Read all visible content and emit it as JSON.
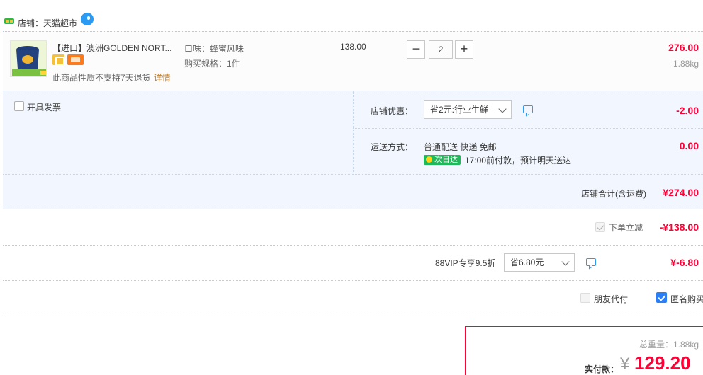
{
  "shop": {
    "label": "店铺：天猫超市"
  },
  "item": {
    "title": "【进口】澳洲GOLDEN NORT...",
    "no_return": "此商品性质不支持7天退货",
    "detail_link": "详情",
    "flavor": "口味：蜂蜜风味",
    "spec": "购买规格：1件",
    "unit_price": "138.00",
    "quantity": "2",
    "minus": "−",
    "plus": "+",
    "subtotal": "276.00",
    "weight": "1.88kg"
  },
  "invoice": {
    "label": "开具发票"
  },
  "promo": {
    "label": "店铺优惠：",
    "selected": "省2元:行业生鲜",
    "amount": "-2.00"
  },
  "shipping": {
    "label": "运送方式：",
    "method": "普通配送 快递 免邮",
    "badge": "次日达",
    "note": "17:00前付款，预计明天送达",
    "amount": "0.00"
  },
  "shop_total": {
    "label": "店铺合计(含运费)",
    "amount": "¥274.00"
  },
  "instant_discount": {
    "label": "下单立减",
    "amount": "-¥138.00"
  },
  "vip": {
    "label": "88VIP专享9.5折",
    "selected": "省6.80元",
    "amount": "¥-6.80"
  },
  "options": {
    "friend_pay": "朋友代付",
    "anonymous": "匿名购买"
  },
  "summary": {
    "total_weight": "总重量：1.88kg",
    "pay_label": "实付款：",
    "currency": "¥",
    "pay_amount": "129.20"
  },
  "colors": {
    "accent_red": "#ff0036",
    "panel_blue": "#f2f7ff",
    "check_blue": "#2a7ef7",
    "badge_green": "#20b85a"
  }
}
